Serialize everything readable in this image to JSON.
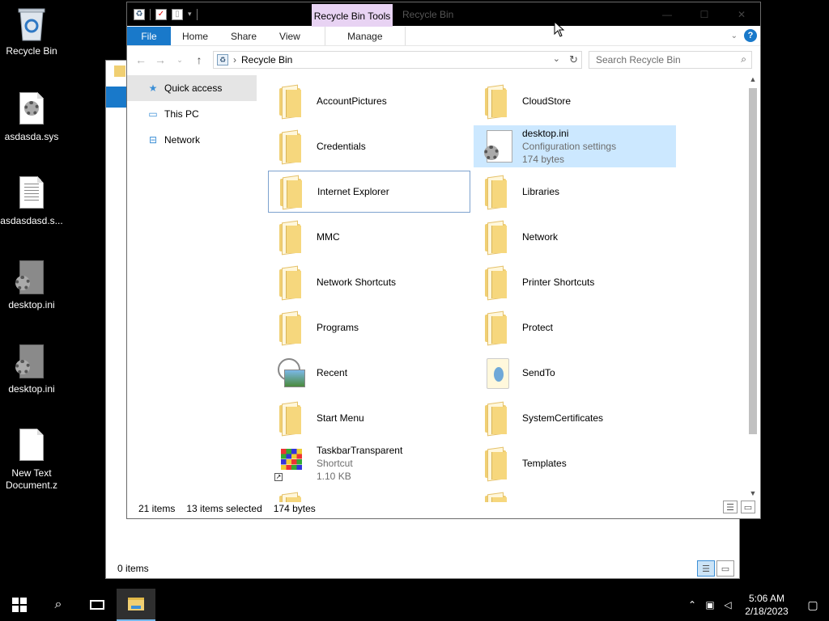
{
  "desktop": {
    "icons": [
      {
        "label": "Recycle Bin",
        "icon": "recycle-bin-icon"
      },
      {
        "label": "asdasda.sys",
        "icon": "system-file-icon"
      },
      {
        "label": "asdasdasd.s...",
        "icon": "text-file-icon"
      },
      {
        "label": "desktop.ini",
        "icon": "config-file-icon"
      },
      {
        "label": "desktop.ini",
        "icon": "config-file-icon"
      },
      {
        "label": "New Text Document.z",
        "icon": "blank-file-icon"
      }
    ]
  },
  "bg_window": {
    "status": "0 items"
  },
  "window": {
    "title": "Recycle Bin",
    "tools_tab": "Recycle Bin Tools",
    "ribbon": {
      "file": "File",
      "home": "Home",
      "share": "Share",
      "view": "View",
      "manage": "Manage"
    },
    "address": {
      "path": "Recycle Bin",
      "search_placeholder": "Search Recycle Bin"
    },
    "nav": {
      "quick_access": "Quick access",
      "this_pc": "This PC",
      "network": "Network"
    },
    "items": [
      {
        "name": "AccountPictures",
        "icon": "folder"
      },
      {
        "name": "CloudStore",
        "icon": "folder"
      },
      {
        "name": "Credentials",
        "icon": "folder"
      },
      {
        "name": "desktop.ini",
        "sub1": "Configuration settings",
        "sub2": "174 bytes",
        "icon": "ini"
      },
      {
        "name": "Internet Explorer",
        "icon": "folder"
      },
      {
        "name": "Libraries",
        "icon": "folder"
      },
      {
        "name": "MMC",
        "icon": "folder"
      },
      {
        "name": "Network",
        "icon": "folder"
      },
      {
        "name": "Network Shortcuts",
        "icon": "folder"
      },
      {
        "name": "Printer Shortcuts",
        "icon": "folder"
      },
      {
        "name": "Programs",
        "icon": "folder"
      },
      {
        "name": "Protect",
        "icon": "folder"
      },
      {
        "name": "Recent",
        "icon": "recent"
      },
      {
        "name": "SendTo",
        "icon": "sendto"
      },
      {
        "name": "Start Menu",
        "icon": "folder"
      },
      {
        "name": "SystemCertificates",
        "icon": "folder"
      },
      {
        "name": "TaskbarTransparent",
        "sub1": "Shortcut",
        "sub2": "1.10 KB",
        "icon": "shortcut"
      },
      {
        "name": "Templates",
        "icon": "folder"
      }
    ],
    "status": {
      "count": "21 items",
      "selected": "13 items selected",
      "size": "174 bytes"
    }
  },
  "taskbar": {
    "time": "5:06 AM",
    "date": "2/18/2023"
  }
}
